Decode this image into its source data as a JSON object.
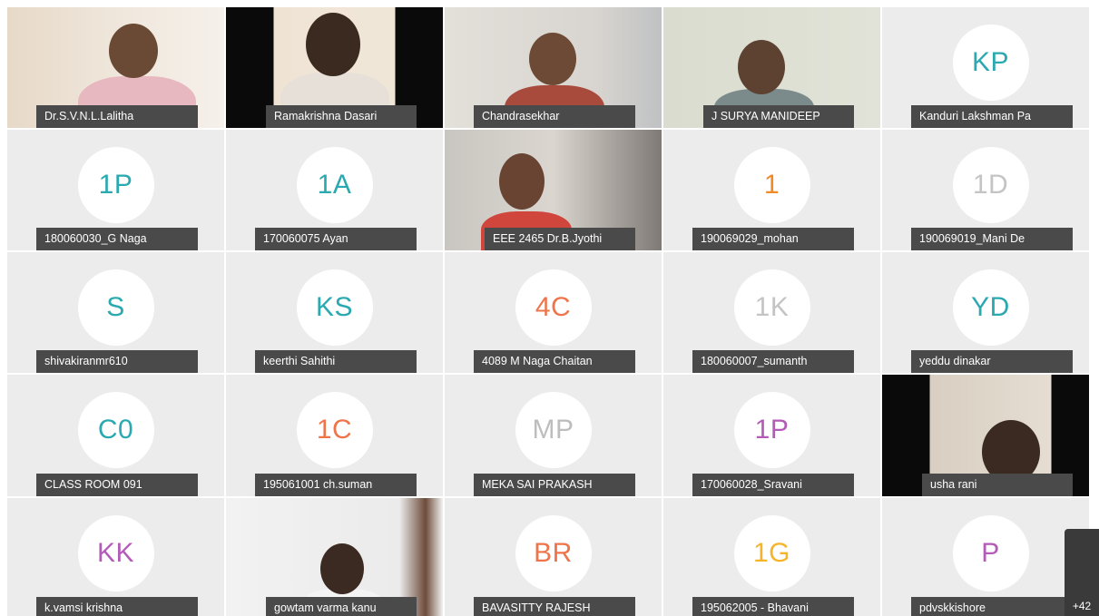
{
  "participants": [
    {
      "name": "Dr.S.V.N.L.Lalitha",
      "video": true
    },
    {
      "name": "Ramakrishna Dasari",
      "video": true
    },
    {
      "name": "Chandrasekhar",
      "video": true
    },
    {
      "name": "J SURYA MANIDEEP",
      "video": true
    },
    {
      "name": "Kanduri Lakshman Pa",
      "initials": "KP",
      "color": "#2aa9b0"
    },
    {
      "name": "180060030_G Naga",
      "initials": "1P",
      "color": "#2aa9b0"
    },
    {
      "name": "170060075 Ayan",
      "initials": "1A",
      "color": "#2aa9b0"
    },
    {
      "name": "EEE 2465 Dr.B.Jyothi",
      "video": true
    },
    {
      "name": "190069029_mohan",
      "initials": "1",
      "color": "#f08a24"
    },
    {
      "name": "190069019_Mani De",
      "initials": "1D",
      "color": "#c4c4c4"
    },
    {
      "name": "shivakiranmr610",
      "initials": "S",
      "color": "#2aa9b0"
    },
    {
      "name": "keerthi Sahithi",
      "initials": "KS",
      "color": "#2aa9b0"
    },
    {
      "name": "4089 M Naga Chaitan",
      "initials": "4C",
      "color": "#f0744a"
    },
    {
      "name": "180060007_sumanth",
      "initials": "1K",
      "color": "#c4c4c4"
    },
    {
      "name": "yeddu dinakar",
      "initials": "YD",
      "color": "#2aa9b0"
    },
    {
      "name": "CLASS ROOM 091",
      "initials": "C0",
      "color": "#2aa9b0"
    },
    {
      "name": "195061001 ch.suman",
      "initials": "1C",
      "color": "#f0744a"
    },
    {
      "name": "MEKA SAI PRAKASH",
      "initials": "MP",
      "color": "#bdbdbd"
    },
    {
      "name": "170060028_Sravani",
      "initials": "1P",
      "color": "#b45ab8"
    },
    {
      "name": "usha rani",
      "video": true
    },
    {
      "name": "k.vamsi krishna",
      "initials": "KK",
      "color": "#b45ab8"
    },
    {
      "name": "gowtam varma kanu",
      "video": true
    },
    {
      "name": "BAVASITTY RAJESH",
      "initials": "BR",
      "color": "#f0744a"
    },
    {
      "name": "195062005 - Bhavani",
      "initials": "1G",
      "color": "#f5b42a"
    },
    {
      "name": "pdvskkishore",
      "initials": "P",
      "color": "#b45ab8"
    }
  ],
  "overflow_count": "+42"
}
